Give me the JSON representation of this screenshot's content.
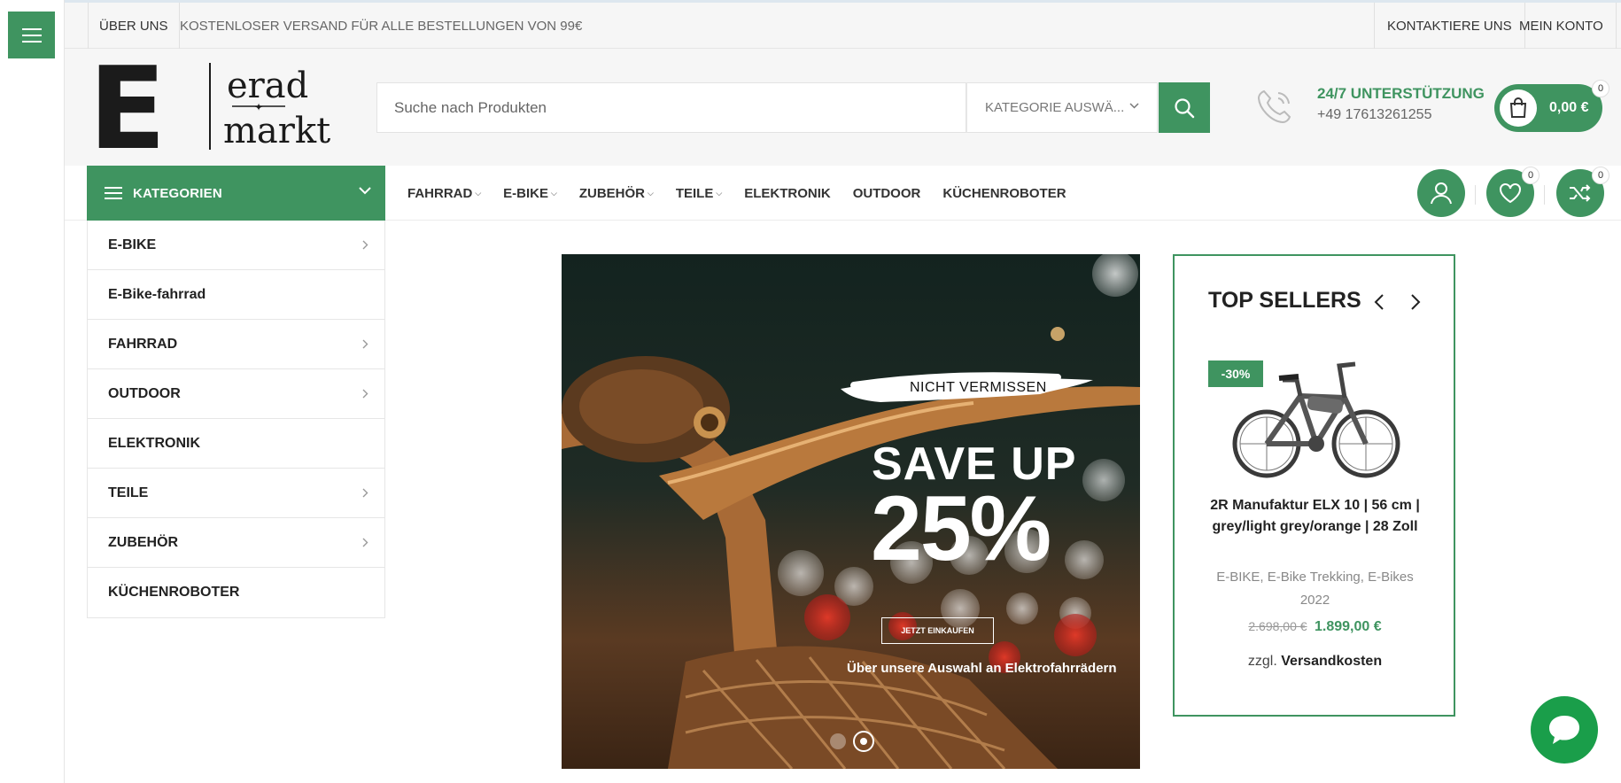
{
  "colors": {
    "brand_green": "#3f9460",
    "chat_green": "#1a9e4a"
  },
  "topbar": {
    "about": "ÜBER UNS",
    "shipping": "KOSTENLOSER VERSAND FÜR ALLE BESTELLUNGEN VON 99€",
    "contact": "KONTAKTIERE UNS",
    "account": "MEIN KONTO"
  },
  "logo": {
    "line1": "erad",
    "line2": "markt",
    "letter": "E"
  },
  "search": {
    "placeholder": "Suche nach Produkten",
    "category_label": "KATEGORIE AUSWÄ...",
    "button_icon": "search-icon"
  },
  "support": {
    "title": "24/7 UNTERSTÜTZUNG",
    "phone": "+49 17613261255"
  },
  "cart": {
    "total": "0,00 €",
    "count": "0"
  },
  "nav": {
    "categories_label": "KATEGORIEN",
    "items": [
      {
        "label": "FAHRRAD",
        "has_dropdown": true
      },
      {
        "label": "E-BIKE",
        "has_dropdown": true
      },
      {
        "label": "ZUBEHÖR",
        "has_dropdown": true
      },
      {
        "label": "TEILE",
        "has_dropdown": true
      },
      {
        "label": "ELEKTRONIK",
        "has_dropdown": false
      },
      {
        "label": "OUTDOOR",
        "has_dropdown": false
      },
      {
        "label": "KÜCHENROBOTER",
        "has_dropdown": false
      }
    ],
    "wishlist_count": "0",
    "compare_count": "0"
  },
  "categories": [
    {
      "label": "E-BIKE",
      "has_sub": true
    },
    {
      "label": "E-Bike-fahrrad",
      "has_sub": false
    },
    {
      "label": "FAHRRAD",
      "has_sub": true
    },
    {
      "label": "OUTDOOR",
      "has_sub": true
    },
    {
      "label": "ELEKTRONIK",
      "has_sub": false
    },
    {
      "label": "TEILE",
      "has_sub": true
    },
    {
      "label": "ZUBEHÖR",
      "has_sub": true
    },
    {
      "label": "KÜCHENROBOTER",
      "has_sub": false
    }
  ],
  "hero": {
    "tag": "NICHT VERMISSEN",
    "headline": "SAVE UP",
    "percent": "25%",
    "cta": "JETZT EINKAUFEN",
    "subtitle": "Über unsere Auswahl an Elektrofahrrädern",
    "slides": 2,
    "active_slide": 2
  },
  "top_sellers": {
    "title": "TOP SELLERS",
    "product": {
      "badge": "-30%",
      "name": "2R Manufaktur ELX 10 | 56 cm | grey/light grey/orange | 28 Zoll",
      "categories": "E-BIKE, E-Bike Trekking, E-Bikes 2022",
      "old_price": "2.698,00 €",
      "price": "1.899,00 €",
      "shipping_prefix": "zzgl.",
      "shipping_link": "Versandkosten"
    }
  }
}
